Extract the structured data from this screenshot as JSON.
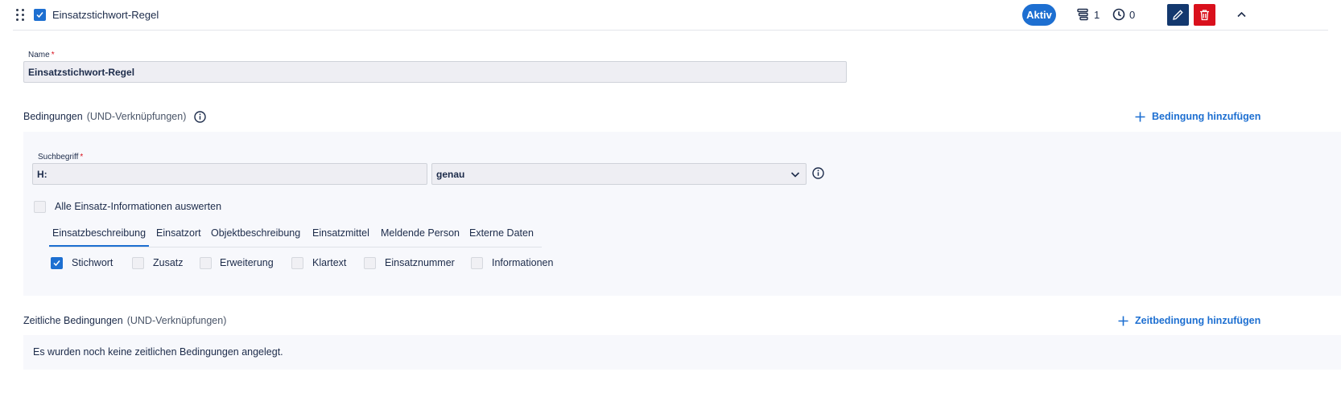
{
  "header": {
    "title": "Einsatzstichwort-Regel",
    "status_badge": "Aktiv",
    "layers_count": "1",
    "clock_count": "0"
  },
  "name_field": {
    "label": "Name",
    "required_mark": "*",
    "value": "Einsatzstichwort-Regel"
  },
  "conditions": {
    "title": "Bedingungen",
    "subtitle": "(UND-Verknüpfungen)",
    "add_label": "Bedingung hinzufügen",
    "search_label": "Suchbegriff",
    "required_mark": "*",
    "search_value": "H:",
    "match_mode": "genau",
    "evaluate_all_label": "Alle Einsatz-Informationen auswerten",
    "tabs": [
      {
        "label": "Einsatzbeschreibung",
        "active": true
      },
      {
        "label": "Einsatzort",
        "active": false
      },
      {
        "label": "Objektbeschreibung",
        "active": false
      },
      {
        "label": "Einsatzmittel",
        "active": false
      },
      {
        "label": "Meldende Person",
        "active": false
      },
      {
        "label": "Externe Daten",
        "active": false
      }
    ],
    "options": [
      {
        "label": "Stichwort",
        "checked": true
      },
      {
        "label": "Zusatz",
        "checked": false
      },
      {
        "label": "Erweiterung",
        "checked": false
      },
      {
        "label": "Klartext",
        "checked": false
      },
      {
        "label": "Einsatznummer",
        "checked": false
      },
      {
        "label": "Informationen",
        "checked": false
      }
    ]
  },
  "time_conditions": {
    "title": "Zeitliche Bedingungen",
    "subtitle": "(UND-Verknüpfungen)",
    "add_label": "Zeitbedingung hinzufügen",
    "empty_message": "Es wurden noch keine zeitlichen Bedingungen angelegt."
  },
  "colors": {
    "accent": "#1d6fd1",
    "edit_button": "#13386e",
    "delete_button": "#d9101c",
    "panel_bg": "#f7f8fc"
  },
  "icons": [
    "drag-handle-icon",
    "checkbox-icon",
    "layers-icon",
    "clock-icon",
    "pencil-icon",
    "trash-icon",
    "chevron-up-icon",
    "info-icon",
    "plus-icon",
    "chevron-down-icon"
  ]
}
